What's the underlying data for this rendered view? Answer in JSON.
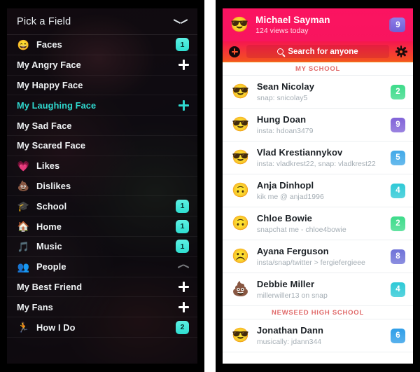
{
  "left_panel": {
    "header": {
      "title": "Pick a Field",
      "collapse_icon": "chevron-down-icon"
    },
    "rows": [
      {
        "label": "Faces",
        "icon": "😄",
        "type": "parent",
        "badge": "1"
      },
      {
        "label": "My Angry Face",
        "icon": "",
        "type": "child",
        "action": "plus"
      },
      {
        "label": "My Happy Face",
        "icon": "",
        "type": "child",
        "action": "none"
      },
      {
        "label": "My Laughing Face",
        "icon": "",
        "type": "child",
        "action": "plus",
        "active": true
      },
      {
        "label": "My Sad Face",
        "icon": "",
        "type": "child",
        "action": "none"
      },
      {
        "label": "My Scared Face",
        "icon": "",
        "type": "child",
        "action": "none"
      },
      {
        "label": "Likes",
        "icon": "💗",
        "type": "parent",
        "action": "none"
      },
      {
        "label": "Dislikes",
        "icon": "💩",
        "type": "parent",
        "action": "none"
      },
      {
        "label": "School",
        "icon": "🎓",
        "type": "parent",
        "badge": "1"
      },
      {
        "label": "Home",
        "icon": "🏠",
        "type": "parent",
        "badge": "1"
      },
      {
        "label": "Music",
        "icon": "🎵",
        "type": "parent",
        "badge": "1"
      },
      {
        "label": "People",
        "icon": "👥",
        "type": "parent",
        "action": "chevron-up"
      },
      {
        "label": "My Best Friend",
        "icon": "",
        "type": "child",
        "action": "plus"
      },
      {
        "label": "My Fans",
        "icon": "",
        "type": "child",
        "action": "plus"
      },
      {
        "label": "How I Do",
        "icon": "🏃",
        "type": "parent",
        "badge": "2"
      }
    ]
  },
  "right_panel": {
    "profile": {
      "avatar": "😎",
      "name": "Michael Sayman",
      "views": "124 views today",
      "badge": "9"
    },
    "search": {
      "placeholder": "Search for anyone",
      "add_icon": "plus-circle-icon",
      "settings_icon": "gear-icon",
      "search_icon": "search-icon"
    },
    "sections": [
      {
        "title": "MY SCHOOL",
        "people": [
          {
            "emoji": "😎",
            "name": "Sean Nicolay",
            "handle": "snap: snicolay5",
            "badge": "2",
            "badge_color": "#3ddb8a"
          },
          {
            "emoji": "😎",
            "name": "Hung Doan",
            "handle": "insta: hdoan3479",
            "badge": "9",
            "badge_color": "#8163d8"
          },
          {
            "emoji": "😎",
            "name": "Vlad Krestiannykov",
            "handle": "insta: vladkrest22, snap: vladkrest22",
            "badge": "5",
            "badge_color": "#42a9e8"
          },
          {
            "emoji": "🙃",
            "name": "Anja Dinhopl",
            "handle": "kik me @ anjad1996",
            "badge": "4",
            "badge_color": "#2ec9d6"
          },
          {
            "emoji": "🙃",
            "name": "Chloe Bowie",
            "handle": "snapchat me - chloe4bowie",
            "badge": "2",
            "badge_color": "#3ddb8a"
          },
          {
            "emoji": "☹️",
            "name": "Ayana Ferguson",
            "handle": "insta/snap/twitter > fergiefergieee",
            "badge": "8",
            "badge_color": "#6f72d8"
          },
          {
            "emoji": "💩",
            "name": "Debbie Miller",
            "handle": "millerwiller13 on snap",
            "badge": "4",
            "badge_color": "#2ec9d6"
          }
        ]
      },
      {
        "title": "NEWSEED HIGH SCHOOL",
        "people": [
          {
            "emoji": "😎",
            "name": "Jonathan Dann",
            "handle": "musically: jdann344",
            "badge": "6",
            "badge_color": "#2f9ee8"
          }
        ]
      }
    ]
  },
  "theme": {
    "accent_cyan": "#2fd9cf",
    "accent_pink": "#fb1361",
    "accent_orange": "#f4541f",
    "section_red": "#e06a6a"
  }
}
